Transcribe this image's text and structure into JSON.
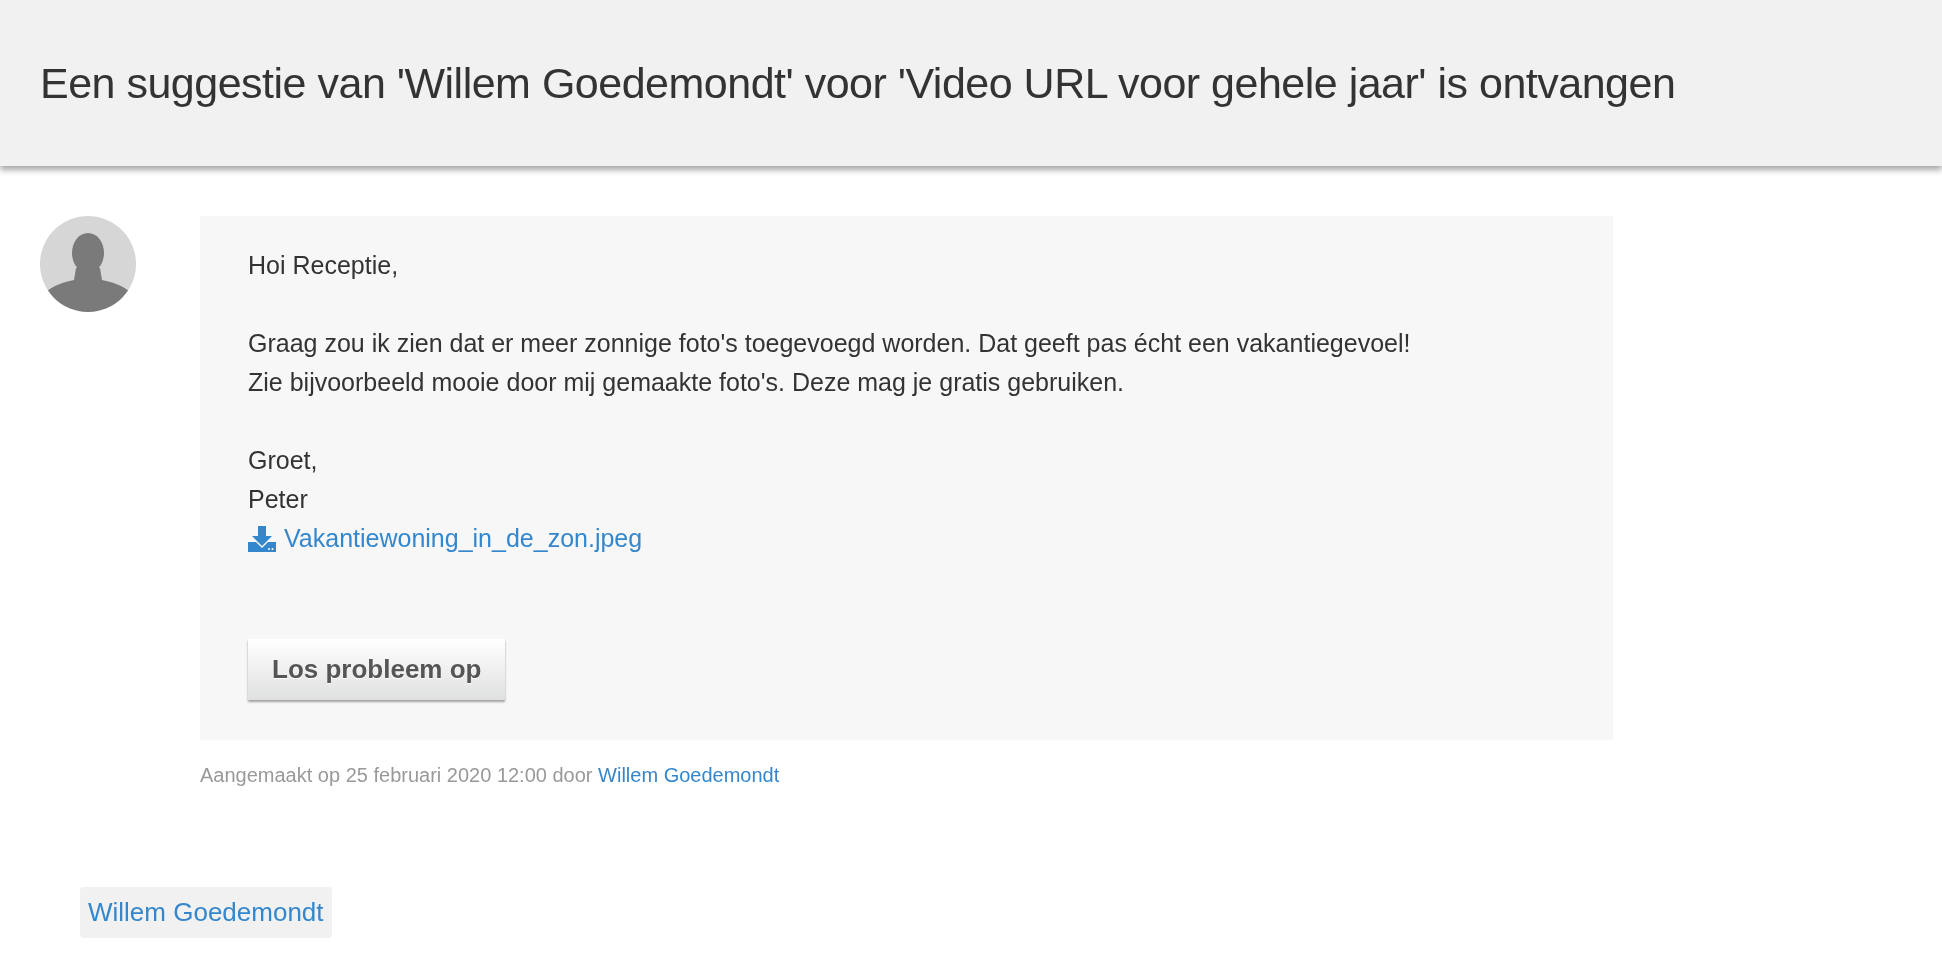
{
  "header": {
    "title": "Een suggestie van 'Willem Goedemondt' voor 'Video URL voor gehele jaar' is ontvangen"
  },
  "message": {
    "paragraphs": [
      [
        "Hoi Receptie,"
      ],
      [
        "Graag zou ik zien dat er meer zonnige foto's toegevoegd worden. Dat geeft pas écht een vakantiegevoel!",
        "Zie bijvoorbeeld mooie door mij gemaakte foto's. Deze mag je gratis gebruiken."
      ],
      [
        "Groet,",
        "Peter"
      ]
    ],
    "attachment": "Vakantiewoning_in_de_zon.jpeg",
    "button": "Los probleem op"
  },
  "meta": {
    "text": "Aangemaakt op 25 februari 2020 12:00 door",
    "author": "Willem Goedemondt"
  },
  "tag": "Willem Goedemondt"
}
